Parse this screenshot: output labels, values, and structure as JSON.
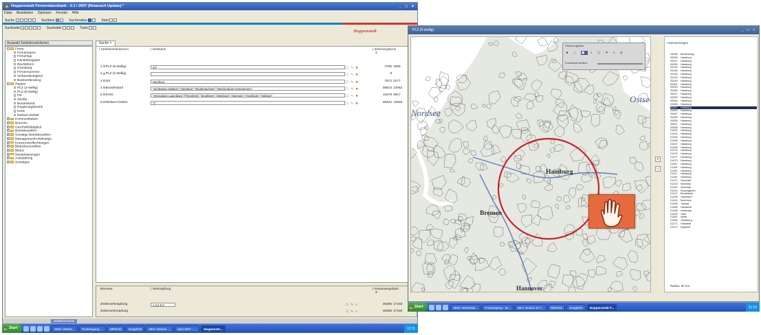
{
  "left_window": {
    "title": "Hoppenstedt Firmendatenbank - 2.1 / 2007 (Relaunch Update) *",
    "window_controls": "_ □ ×",
    "menu": [
      "Datei",
      "Bearbeiten",
      "Optionen",
      "Fenster",
      "Hilfe"
    ],
    "toolbar1": {
      "suche": "Suche",
      "suchbox": "Suchbox",
      "suchmodus": "Suchmodus",
      "start": "Start"
    },
    "toolbar2": {
      "suchseite": "Suchseite",
      "suchziele": "Suchziele",
      "tools": "Tools"
    },
    "logo_text": "Hoppenstedt",
    "tree_header": "Auswahl Selektionskriterien",
    "tree": [
      {
        "label": "Firma",
        "type": "folder",
        "level": 0,
        "toggle": "-"
      },
      {
        "label": "Firmenname",
        "type": "leaf",
        "level": 2
      },
      {
        "label": "Firmentyp",
        "type": "leaf",
        "level": 2
      },
      {
        "label": "Handelsregister",
        "type": "leaf",
        "level": 2
      },
      {
        "label": "Rechtsform",
        "type": "leaf",
        "level": 2
      },
      {
        "label": "Gründung",
        "type": "leaf",
        "level": 2
      },
      {
        "label": "Firmennummer",
        "type": "leaf",
        "level": 2
      },
      {
        "label": "Verbandsmitglied",
        "type": "leaf",
        "level": 2
      },
      {
        "label": "Bankverbindung",
        "type": "leaf",
        "level": 2
      },
      {
        "label": "Region",
        "type": "folder",
        "level": 0,
        "toggle": "-"
      },
      {
        "label": "PLZ (2-stellig)",
        "type": "leaf",
        "level": 2
      },
      {
        "label": "PLZ (5-stellig)",
        "type": "leaf",
        "level": 2
      },
      {
        "label": "Ort",
        "type": "leaf",
        "level": 2
      },
      {
        "label": "Straße",
        "type": "leaf",
        "level": 2
      },
      {
        "label": "Bundesland",
        "type": "leaf",
        "level": 2
      },
      {
        "label": "Regierungsbezirk",
        "type": "leaf",
        "level": 2
      },
      {
        "label": "Kreis",
        "type": "leaf",
        "level": 2
      },
      {
        "label": "Nielsen-Gebiet",
        "type": "leaf",
        "level": 2
      },
      {
        "label": "Kommunikation",
        "type": "folder",
        "level": 0,
        "toggle": "+"
      },
      {
        "label": "Branche",
        "type": "folder",
        "level": 0,
        "toggle": "+"
      },
      {
        "label": "Geschäftstätigkeit",
        "type": "folder",
        "level": 0,
        "toggle": "+"
      },
      {
        "label": "Betriebszahlen",
        "type": "folder",
        "level": 0,
        "toggle": "+"
      },
      {
        "label": "Sonstige Betriebszahlen",
        "type": "folder",
        "level": 0,
        "toggle": "+"
      },
      {
        "label": "Management/Anteilseign.",
        "type": "folder",
        "level": 0,
        "toggle": "+"
      },
      {
        "label": "Konzernverflechtungen",
        "type": "folder",
        "level": 0,
        "toggle": "+"
      },
      {
        "label": "Bilanzkennzahlen",
        "type": "folder",
        "level": 0,
        "toggle": "+"
      },
      {
        "label": "Bilanz",
        "type": "folder",
        "level": 0,
        "toggle": "+"
      },
      {
        "label": "Niederlassungen",
        "type": "folder",
        "level": 0,
        "toggle": "+"
      },
      {
        "label": "Ausstattung",
        "type": "folder",
        "level": 0,
        "toggle": "+"
      },
      {
        "label": "Sonstiges",
        "type": "folder",
        "level": 0,
        "toggle": "+"
      }
    ],
    "tab_label": "Suche ×",
    "columns": {
      "kriterium": "Selektionskriterium",
      "selektion": "Selektion",
      "zeilen": "Zeilenergebnis"
    },
    "rows": [
      {
        "num": "1",
        "label": "PLZ (5-stellig)",
        "value": "40*",
        "count": "4705",
        "count2": "3306"
      },
      {
        "num": "2",
        "label": "PLZ (2-stellig)",
        "value": "",
        "count": "8",
        "count2": ""
      },
      {
        "num": "3",
        "label": "Ort",
        "value": "Hamburg",
        "count": "7572",
        "count2": "3177"
      },
      {
        "num": "4",
        "label": "Bundesland",
        "value": "\"Schleswig-Holstein\";\"Hamburg\";\"Niedersachsen\";\"Mecklenburg-Vorpommern\"",
        "count": "38813",
        "count2": "14062"
      },
      {
        "num": "5",
        "label": "Kreis",
        "value": "\"Herzogtum Lauenburg\";\"Pinneberg\";\"Segeberg\";\"Steinburg\";\"Stormarn\";\"Hamburg\";\"Harburg\"",
        "count": "11678",
        "count2": "4817"
      },
      {
        "num": "6",
        "label": "Nielsen-Gebiet",
        "value": "\"1\"",
        "count": "36432",
        "count2": "13646"
      }
    ],
    "row_icons": "☐ ✎ ✖",
    "bottom": {
      "col_element": "Element",
      "col_verknuepfung": "Verknüpfung",
      "col_gesamt": "Gesamtergebnis",
      "rows": [
        {
          "label": "Zeilenverknüpfung",
          "value": "1.3.4.5.6",
          "c1": "45295",
          "c2": "17192"
        },
        {
          "label": "Seitenverknüpfung",
          "value": "",
          "c1": "45295",
          "c2": "17192"
        }
      ],
      "icons": "☐ ✎ ⌕"
    },
    "status_text": "Selektionsseite",
    "taskbar": {
      "start": "Start",
      "items": [
        "MMC Werbe...",
        "Posteingang ...",
        "NRW/32",
        "SnagIt/32",
        "NEX Version ...",
        "April 2007 - ...",
        "Hoppenste..."
      ],
      "active_index": 6,
      "clock": "12:11"
    }
  },
  "right_window": {
    "title": "PLZ (5-stellig)",
    "window_controls": "_ □ ×",
    "map_labels": {
      "sea_west": "Nordsee",
      "sea_east": "Ostsee",
      "city1": "Hamburg",
      "city2": "Bremen",
      "city3": "Hannover"
    },
    "map_tool": {
      "title": "Werkzeugleiste",
      "icons": [
        "◄",
        "⌂",
        "▣",
        "⌕",
        "↻",
        "✥",
        "⌕",
        "⊡"
      ],
      "zoom_label": "Zoomstufe ändern"
    },
    "scroll_buttons": [
      "+",
      "−"
    ],
    "plz_header": "Hamvertungen",
    "plz_list": [
      [
        "19258",
        "Boizenburg"
      ],
      [
        "20095",
        "Hamburg"
      ],
      [
        "20097",
        "Hamburg"
      ],
      [
        "20099",
        "Hamburg"
      ],
      [
        "20144",
        "Hamburg"
      ],
      [
        "20146",
        "Hamburg"
      ],
      [
        "20148",
        "Hamburg"
      ],
      [
        "20149",
        "Hamburg"
      ],
      [
        "20249",
        "Hamburg"
      ],
      [
        "20251",
        "Hamburg"
      ],
      [
        "20253",
        "Hamburg"
      ],
      [
        "20255",
        "Hamburg"
      ],
      [
        "20257",
        "Hamburg"
      ],
      [
        "20259",
        "Hamburg"
      ],
      [
        "20354",
        "Hamburg"
      ],
      [
        "20355",
        "Hamburg"
      ],
      [
        "20357",
        "Hamburg"
      ],
      [
        "20359",
        "Hamburg"
      ],
      [
        "20457",
        "Hamburg"
      ],
      [
        "20459",
        "Hamburg"
      ],
      [
        "20535",
        "Hamburg"
      ],
      [
        "20537",
        "Hamburg"
      ],
      [
        "20539",
        "Hamburg"
      ],
      [
        "21029",
        "Hamburg"
      ],
      [
        "21031",
        "Hamburg"
      ],
      [
        "21033",
        "Hamburg"
      ],
      [
        "21035",
        "Hamburg"
      ],
      [
        "21037",
        "Hamburg"
      ],
      [
        "21039",
        "Hamburg"
      ],
      [
        "21073",
        "Hamburg"
      ],
      [
        "21075",
        "Hamburg"
      ],
      [
        "21077",
        "Hamburg"
      ],
      [
        "21079",
        "Hamburg"
      ],
      [
        "21107",
        "Hamburg"
      ],
      [
        "21109",
        "Hamburg"
      ],
      [
        "21129",
        "Hamburg"
      ],
      [
        "21147",
        "Hamburg"
      ],
      [
        "21149",
        "Hamburg"
      ],
      [
        "21217",
        "Seevetal"
      ],
      [
        "21218",
        "Seevetal"
      ],
      [
        "21220",
        "Seevetal"
      ],
      [
        "21224",
        "Rosengarten"
      ],
      [
        "21227",
        "Bendestorf"
      ],
      [
        "21228",
        "Harmstorf"
      ],
      [
        "21244",
        "Buchholz"
      ],
      [
        "21255",
        "Tostedt"
      ],
      [
        "21256",
        "Handeloh"
      ],
      [
        "21258",
        "Heidenau"
      ],
      [
        "21259",
        "Otter"
      ],
      [
        "21261",
        "Welle"
      ],
      [
        "21266",
        "Jesteburg"
      ],
      [
        "21271",
        "Hanstedt"
      ],
      [
        "21272",
        "Egestorf"
      ]
    ],
    "selected_index": 16,
    "radius_text": "Radius:  82 Km",
    "taskbar": {
      "start": "Start",
      "items": [
        "MMC Werbedat...",
        "Posteingang - M...",
        "NEX Version D-T...",
        "NRW/32",
        "SnagIt/32",
        "Hoppenstedt F..."
      ],
      "active_index": 5,
      "clock": "11:10"
    }
  },
  "colors": {
    "accent_blue": "#1b7fc2",
    "accent_red": "#d0342c",
    "map_circle": "#c8202a",
    "hand_orange": "#e56a3d",
    "selection": "#1d2c5b"
  }
}
